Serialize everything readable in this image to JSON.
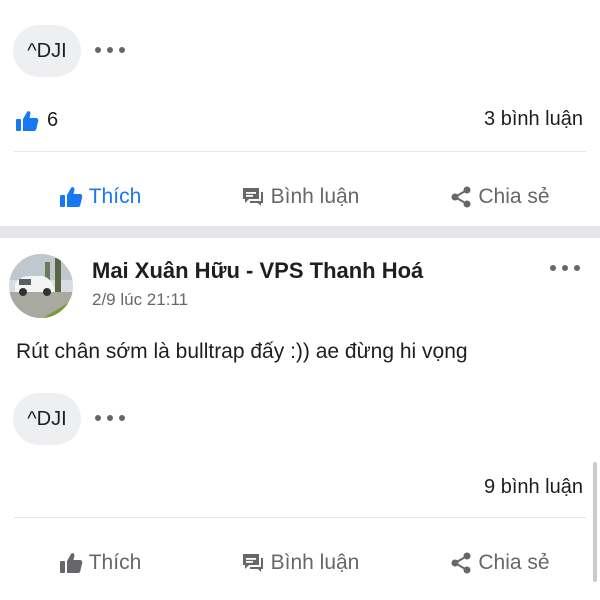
{
  "post1": {
    "tag": "^DJI",
    "like_count": "6",
    "comment_count": "3 bình luận",
    "actions": {
      "like": "Thích",
      "comment": "Bình luận",
      "share": "Chia sẻ"
    }
  },
  "post2": {
    "author": "Mai Xuân Hữu - VPS Thanh Hoá",
    "timestamp": "2/9 lúc 21:11",
    "content": "Rút chân sớm là bulltrap đấy :)) ae đừng hi vọng",
    "tag": "^DJI",
    "comment_count": "9 bình luận",
    "actions": {
      "like": "Thích",
      "comment": "Bình luận",
      "share": "Chia sẻ"
    }
  },
  "colors": {
    "accent": "#1877f2",
    "secondary_text": "#65676b",
    "chip_bg": "#eeeff1",
    "separator": "#e4e6eb"
  }
}
